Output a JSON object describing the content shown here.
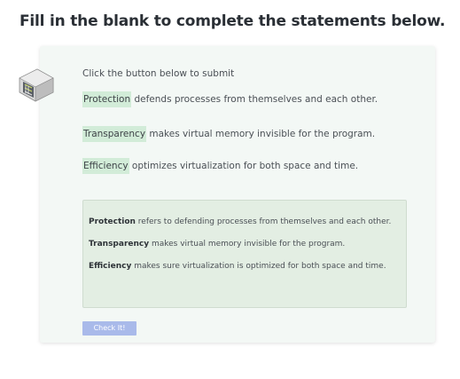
{
  "heading": "Fill in the blank to complete the statements below.",
  "icon": "server-rack-icon",
  "instruction": "Click the button below to submit",
  "statements": [
    {
      "blank": "Protection",
      "rest": " defends processes from themselves and each other."
    },
    {
      "blank": "Transparency",
      "rest": " makes virtual memory invisible for the program."
    },
    {
      "blank": "Efficiency",
      "rest": " optimizes virtualization for both space and time."
    }
  ],
  "answers": [
    {
      "term": "Protection",
      "text": " refers to defending processes from themselves and each other."
    },
    {
      "term": "Transparency",
      "text": " makes virtual memory invisible for the program."
    },
    {
      "term": "Efficiency",
      "text": " makes sure virtualization is optimized for both space and time."
    }
  ],
  "check_button": "Check It!",
  "colors": {
    "blank_bg": "#d2ecd8",
    "card_bg": "#f3f8f5",
    "answer_bg": "#e3eee3",
    "button_bg": "#a9baea"
  }
}
